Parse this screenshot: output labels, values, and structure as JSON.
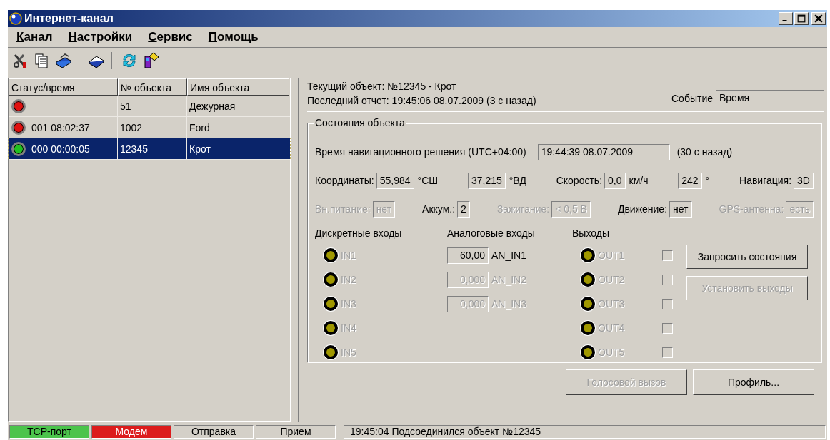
{
  "window": {
    "title": "Интернет-канал"
  },
  "menu": [
    {
      "label": "Канал"
    },
    {
      "label": "Настройки"
    },
    {
      "label": "Сервис"
    },
    {
      "label": "Помощь"
    }
  ],
  "objects": {
    "columns": [
      "Статус/время",
      "№ объекта",
      "Имя объекта"
    ],
    "rows": [
      {
        "color": "#e01010",
        "time": "",
        "number": "51",
        "name": "Дежурная",
        "selected": false
      },
      {
        "color": "#e01010",
        "time": "001 08:02:37",
        "number": "1002",
        "name": "Ford",
        "selected": false
      },
      {
        "color": "#20c020",
        "time": "000 00:00:05",
        "number": "12345",
        "name": "Крот",
        "selected": true
      }
    ]
  },
  "current_object": "Текущий объект:  №12345  -  Крот",
  "last_report": "Последний отчет: 19:45:06 08.07.2009   (3 с назад)",
  "event": {
    "label": "Событие",
    "value": "Время"
  },
  "state_group": {
    "title": "Состояния объекта",
    "nav_time": {
      "label": "Время  навигационного решения (UTC+04:00)",
      "value": "19:44:39 08.07.2009",
      "ago": "(30 с назад)"
    },
    "rows": [
      [
        {
          "label": "Координаты:",
          "value": "55,984",
          "unit": "°СШ",
          "disabled": false
        },
        {
          "value": "37,215",
          "unit": "°ВД",
          "disabled": false
        },
        {
          "label": "Скорость:",
          "value": "0,0",
          "unit": "км/ч",
          "disabled": false
        },
        {
          "value": "242",
          "unit": "°",
          "disabled": false
        },
        {
          "label": "Навигация:",
          "value": "3D",
          "disabled": false
        }
      ],
      [
        {
          "label": "Вн.питание:",
          "value": "нет",
          "disabled": true
        },
        {
          "label": "Аккум.:",
          "value": "2",
          "disabled": false
        },
        {
          "label": "Зажигание:",
          "value": "< 0,5 В",
          "disabled": true
        },
        {
          "label": "Движение:",
          "value": "нет",
          "disabled": false
        },
        {
          "label": "GPS-антенна:",
          "value": "есть",
          "disabled": true
        }
      ]
    ],
    "discrete_title": "Дискретные входы",
    "analog_title": "Аналоговые входы",
    "outputs_title": "Выходы",
    "discrete": [
      {
        "label": "IN1"
      },
      {
        "label": "IN2"
      },
      {
        "label": "IN3"
      },
      {
        "label": "IN4"
      },
      {
        "label": "IN5"
      }
    ],
    "analog": [
      {
        "value": "60,00",
        "name": "AN_IN1",
        "disabled": false
      },
      {
        "value": "0,000",
        "name": "AN_IN2",
        "disabled": true
      },
      {
        "value": "0,000",
        "name": "AN_IN3",
        "disabled": true
      }
    ],
    "outputs": [
      {
        "label": "OUT1",
        "checked": false
      },
      {
        "label": "OUT2",
        "checked": false
      },
      {
        "label": "OUT3",
        "checked": false
      },
      {
        "label": "OUT4",
        "checked": false
      },
      {
        "label": "OUT5",
        "checked": false
      }
    ],
    "side_buttons": [
      {
        "label": "Запросить состояния",
        "disabled": false
      },
      {
        "label": "Установить выходы",
        "disabled": true
      }
    ]
  },
  "bottom_buttons": [
    {
      "label": "Голосовой вызов",
      "disabled": true
    },
    {
      "label": "Профиль...",
      "disabled": false
    }
  ],
  "status_bar": {
    "panels": [
      {
        "text": "TCP-порт",
        "color": "#4cc44c"
      },
      {
        "text": "Модем",
        "color": "#dc1c1c"
      },
      {
        "text": "Отправка",
        "color": "#d4d0c8"
      },
      {
        "text": "Прием",
        "color": "#d4d0c8"
      }
    ],
    "message": "19:45:04  Подсоединился объект №12345"
  }
}
